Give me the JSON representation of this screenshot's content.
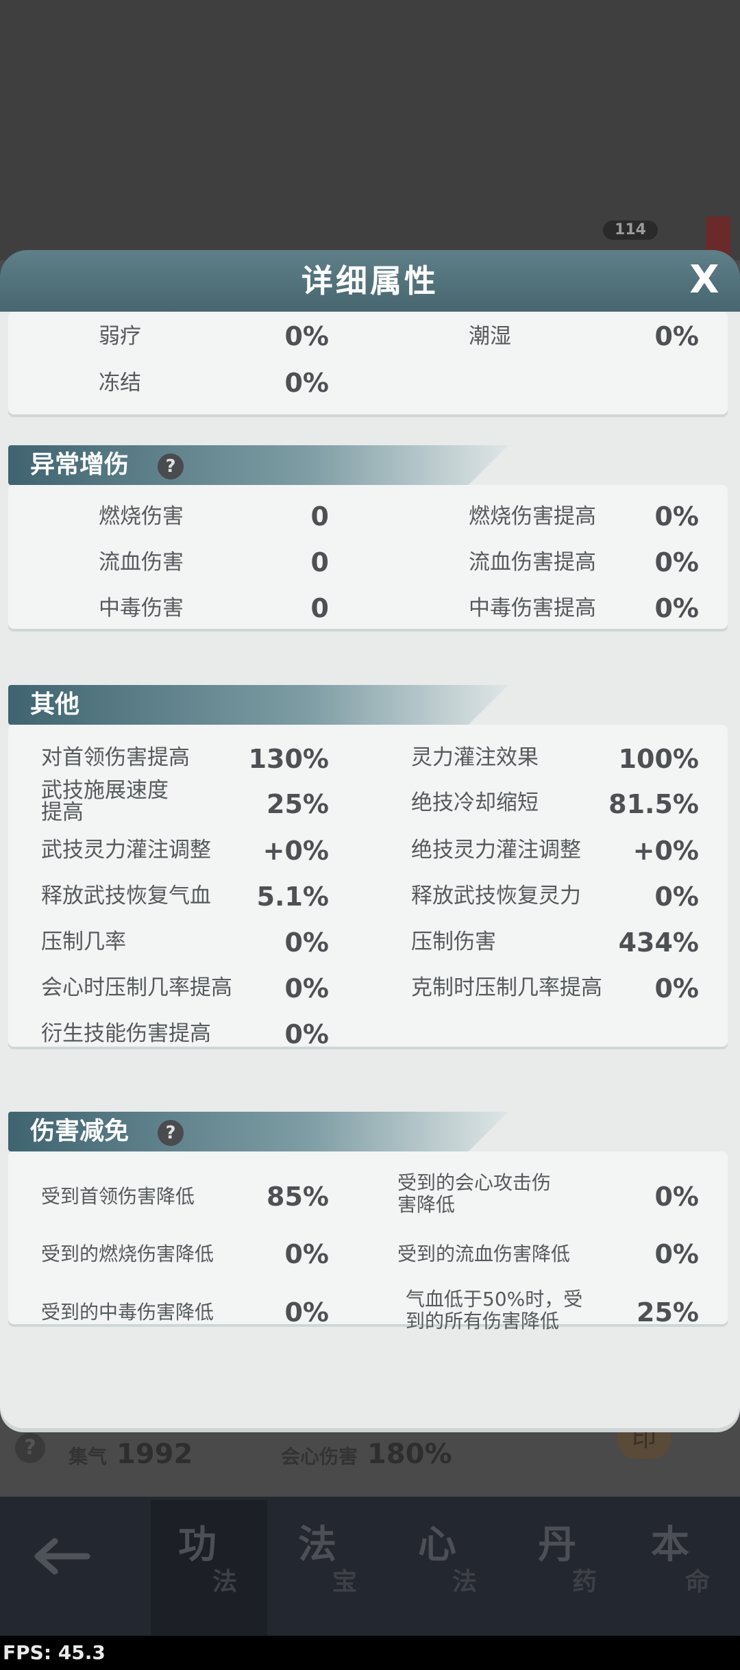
{
  "background": {
    "level_badge": "114",
    "stats": [
      {
        "label": "集气",
        "value": "1992"
      },
      {
        "label": "会心伤害",
        "value": "180%"
      }
    ]
  },
  "modal": {
    "title": "详细属性",
    "close_label": "X",
    "top_section": {
      "rows": [
        {
          "label": "弱疗",
          "value": "0%"
        },
        {
          "label": "潮湿",
          "value": "0%"
        },
        {
          "label": "冻结",
          "value": "0%"
        }
      ]
    },
    "abnormal_section": {
      "title": "异常增伤",
      "rows": [
        {
          "label": "燃烧伤害",
          "value": "0"
        },
        {
          "label": "燃烧伤害提高",
          "value": "0%"
        },
        {
          "label": "流血伤害",
          "value": "0"
        },
        {
          "label": "流血伤害提高",
          "value": "0%"
        },
        {
          "label": "中毒伤害",
          "value": "0"
        },
        {
          "label": "中毒伤害提高",
          "value": "0%"
        }
      ]
    },
    "other_section": {
      "title": "其他",
      "rows": [
        {
          "label": "对首领伤害提高",
          "value": "130%"
        },
        {
          "label": "灵力灌注效果",
          "value": "100%"
        },
        {
          "label_line1": "武技施展速度",
          "label_line2": "提高",
          "value": "25%"
        },
        {
          "label": "绝技冷却缩短",
          "value": "81.5%"
        },
        {
          "label": "武技灵力灌注调整",
          "value": "+0%"
        },
        {
          "label": "绝技灵力灌注调整",
          "value": "+0%"
        },
        {
          "label": "释放武技恢复气血",
          "value": "5.1%"
        },
        {
          "label": "释放武技恢复灵力",
          "value": "0%"
        },
        {
          "label": "压制几率",
          "value": "0%"
        },
        {
          "label": "压制伤害",
          "value": "434%"
        },
        {
          "label": "会心时压制几率提高",
          "value": "0%"
        },
        {
          "label": "克制时压制几率提高",
          "value": "0%"
        },
        {
          "label": "衍生技能伤害提高",
          "value": "0%"
        }
      ]
    },
    "reduction_section": {
      "title": "伤害减免",
      "rows": [
        {
          "label": "受到首领伤害降低",
          "value": "85%"
        },
        {
          "label_line1": "受到的会心攻击伤",
          "label_line2": "害降低",
          "value": "0%"
        },
        {
          "label": "受到的燃烧伤害降低",
          "value": "0%"
        },
        {
          "label": "受到的流血伤害降低",
          "value": "0%"
        },
        {
          "label": "受到的中毒伤害降低",
          "value": "0%"
        },
        {
          "label_line1": "气血低于50%时，受",
          "label_line2": "到的所有伤害降低",
          "value": "25%"
        }
      ]
    }
  },
  "nav": {
    "back_icon": "arrow-left-icon",
    "tabs": [
      {
        "big": "功",
        "small": "法"
      },
      {
        "big": "法",
        "small": "宝"
      },
      {
        "big": "心",
        "small": "法"
      },
      {
        "big": "丹",
        "small": "药"
      },
      {
        "big": "本",
        "small": "命"
      }
    ]
  },
  "fps": "FPS: 45.3"
}
